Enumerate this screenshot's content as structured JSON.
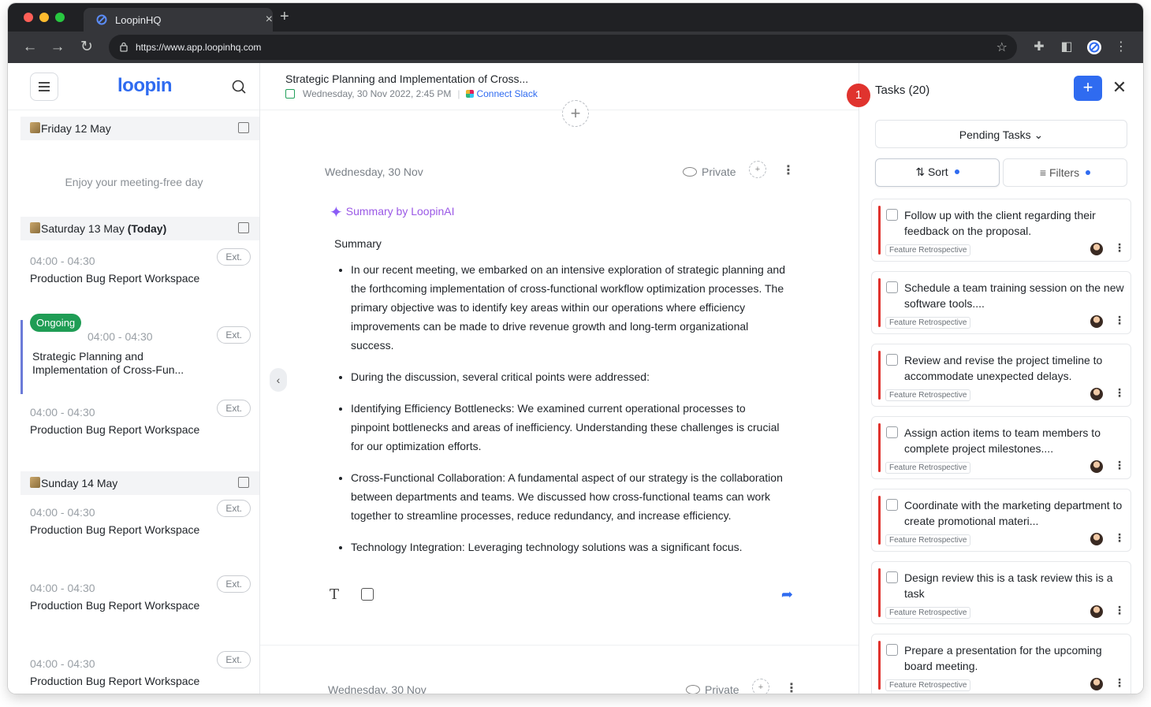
{
  "browser": {
    "tab_title": "LoopinHQ",
    "tab_close": "×",
    "new_tab": "+",
    "url": "https://www.app.loopinhq.com",
    "traffic_colors": [
      "#ff5f57",
      "#febc2e",
      "#28c840"
    ]
  },
  "sidebar": {
    "logo": "loopin",
    "days": [
      {
        "label": "Friday 12 May",
        "today": ""
      },
      {
        "label": "Saturday 13 May",
        "today": "(Today)"
      },
      {
        "label": "Sunday 14 May",
        "today": ""
      }
    ],
    "free_text": "Enjoy your meeting-free day",
    "meetings": [
      {
        "time": "04:00 - 04:30",
        "name": "Production Bug Report Workspace",
        "ext": "Ext."
      },
      {
        "time": "04:00 - 04:30",
        "name": "Strategic Planning and Implementation of Cross-Fun...",
        "ext": "Ext.",
        "status": "Ongoing"
      },
      {
        "time": "04:00 - 04:30",
        "name": "Production Bug Report Workspace",
        "ext": "Ext."
      },
      {
        "time": "04:00 - 04:30",
        "name": "Production Bug Report Workspace",
        "ext": "Ext."
      },
      {
        "time": "04:00 - 04:30",
        "name": "Production Bug Report Workspace",
        "ext": "Ext."
      },
      {
        "time": "04:00 - 04:30",
        "name": "Production Bug Report Workspace",
        "ext": "Ext."
      }
    ]
  },
  "main": {
    "title": "Strategic Planning and Implementation of Cross...",
    "datetime": "Wednesday, 30 Nov 2022, 2:45 PM",
    "connect_slack": "Connect Slack",
    "note_date": "Wednesday, 30 Nov",
    "private_label": "Private",
    "ai_title": "Summary by LoopinAI",
    "summary_heading": "Summary",
    "bullets": [
      "In our recent meeting, we embarked on an intensive exploration of strategic planning and the forthcoming implementation of cross-functional workflow optimization processes. The primary objective was to identify key areas within our operations where efficiency improvements can be made to drive revenue growth and long-term organizational success.",
      "During the discussion, several critical points were addressed:",
      "Identifying Efficiency Bottlenecks: We examined current operational processes to pinpoint bottlenecks and areas of inefficiency. Understanding these challenges is crucial for our optimization efforts.",
      " Cross-Functional Collaboration: A fundamental aspect of our strategy is the collaboration between departments and teams. We discussed how cross-functional teams can work together to streamline processes, reduce redundancy, and increase efficiency.",
      "Technology Integration: Leveraging technology solutions was a significant focus."
    ],
    "note2_date": "Wednesday, 30 Nov",
    "private2_label": "Private"
  },
  "tasks": {
    "badge": "1",
    "title": "Tasks (20)",
    "pending_label": "Pending Tasks",
    "sort_label": "Sort",
    "filters_label": "Filters",
    "accent": "#2f6bf0",
    "priority_color": "#e0332e",
    "items": [
      {
        "text": "Follow up with the client regarding their feedback on the proposal.",
        "tag": "Feature Retrospective"
      },
      {
        "text": "Schedule a team training session on the new software tools....",
        "tag": "Feature Retrospective"
      },
      {
        "text": "Review and revise the project timeline to accommodate unexpected delays.",
        "tag": "Feature Retrospective"
      },
      {
        "text": "Assign action items to team members to complete project milestones....",
        "tag": "Feature Retrospective"
      },
      {
        "text": "Coordinate with the marketing department to create promotional materi...",
        "tag": "Feature Retrospective"
      },
      {
        "text": "Design review this is a task review this is a task",
        "tag": "Feature Retrospective"
      },
      {
        "text": "Prepare a presentation for the upcoming board meeting.",
        "tag": "Feature Retrospective"
      }
    ]
  }
}
